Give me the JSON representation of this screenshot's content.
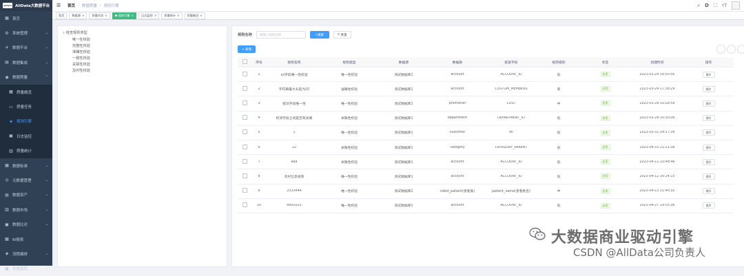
{
  "brand": {
    "logo_text": "alldata",
    "name": "AllData大数据平台"
  },
  "sidebar": {
    "items": [
      {
        "icon": "dashboard-icon",
        "glyph": "▦",
        "label": "首页",
        "type": "top"
      },
      {
        "icon": "gear-icon",
        "glyph": "⚙",
        "label": "系统管理",
        "type": "group"
      },
      {
        "icon": "send-icon",
        "glyph": "✈",
        "label": "数据平台",
        "type": "group"
      },
      {
        "icon": "chart-icon",
        "glyph": "▤",
        "label": "数据集成",
        "type": "group"
      },
      {
        "icon": "database-icon",
        "glyph": "◉",
        "label": "数据质量",
        "type": "group",
        "open": true
      },
      {
        "icon": "grid-icon",
        "glyph": "▦",
        "label": "质量概览",
        "type": "sub"
      },
      {
        "icon": "document-icon",
        "glyph": "▭",
        "label": "质量任务",
        "type": "sub"
      },
      {
        "icon": "rule-icon",
        "glyph": "◈",
        "label": "规则引擎",
        "type": "sub",
        "active": true
      },
      {
        "icon": "monitor-icon",
        "glyph": "▣",
        "label": "日志监控",
        "type": "sub"
      },
      {
        "icon": "statistics-icon",
        "glyph": "▥",
        "label": "质量统计",
        "type": "sub"
      },
      {
        "icon": "standard-icon",
        "glyph": "▦",
        "label": "数据标准",
        "type": "group"
      },
      {
        "icon": "metadata-icon",
        "glyph": "◎",
        "label": "元数据管理",
        "type": "group"
      },
      {
        "icon": "asset-icon",
        "glyph": "▤",
        "label": "数据资产",
        "type": "group"
      },
      {
        "icon": "market-icon",
        "glyph": "▥",
        "label": "数据市场",
        "type": "group"
      },
      {
        "icon": "compare-icon",
        "glyph": "▣",
        "label": "数据比对",
        "type": "group"
      },
      {
        "icon": "table-icon",
        "glyph": "▦",
        "label": "BI报表",
        "type": "top"
      },
      {
        "icon": "flow-icon",
        "glyph": "◈",
        "label": "流程编排",
        "type": "group"
      },
      {
        "icon": "system-monitor-icon",
        "glyph": "▣",
        "label": "系统监控",
        "type": "group"
      }
    ]
  },
  "breadcrumb": [
    "首页",
    "数据质量",
    "规则引擎"
  ],
  "tags": [
    {
      "label": "首页",
      "active": false,
      "closable": false
    },
    {
      "label": "数据源",
      "active": false,
      "closable": true
    },
    {
      "label": "质量任务",
      "active": false,
      "closable": true
    },
    {
      "label": "规则引擎",
      "active": true,
      "closable": true
    },
    {
      "label": "日志监控",
      "active": false,
      "closable": true
    },
    {
      "label": "质量统计",
      "active": false,
      "closable": true
    },
    {
      "label": "质量概况",
      "active": false,
      "closable": true
    }
  ],
  "tree": {
    "root": "核查规则类型",
    "children": [
      "唯一性校验",
      "完整性校验",
      "准确性校验",
      "一致性校验",
      "关联性校验",
      "及时性校验"
    ]
  },
  "search": {
    "label": "规则名称",
    "placeholder": "请输入规则名称",
    "search_label": "搜索",
    "reset_label": "重置",
    "add_label": "+ 新增"
  },
  "table": {
    "headers": [
      "",
      "序号",
      "规则名称",
      "规则类型",
      "数据源",
      "数据表",
      "核查字段",
      "规则级别",
      "状态",
      "创建时间",
      "操作"
    ],
    "rows": [
      [
        "1",
        "xx字段唯一性校验",
        "唯一性校验",
        "测试数据库1",
        "account",
        "ACCOUNT_ID",
        "低",
        "启用",
        "2023-03-24 16:50:56",
        "操作"
      ],
      [
        "2",
        "字符串最大长度为10",
        "准确性校验",
        "测试数据库1",
        "account",
        "CUSTOM_MEMBERS",
        "高",
        "启用",
        "2023-03-24 17:38:29",
        "操作"
      ],
      [
        "3",
        "核派字段唯一性",
        "唯一性校验",
        "测试数据库1",
        "promotion",
        "COST",
        "中",
        "启用",
        "2023-03-28 10:28:59",
        "操作"
      ],
      [
        "4",
        "校测字段之间是否有关联",
        "关联性校验",
        "测试数据库1",
        "department",
        "DEPARTMENT_ID",
        "低",
        "启用",
        "2023-03-28 10:30:06",
        "操作"
      ],
      [
        "5",
        "1",
        "唯一性校验",
        "测试数据库1",
        "customer",
        "MI",
        "低",
        "启用",
        "2023-03-31 09:17:34",
        "操作"
      ],
      [
        "6",
        "22",
        "关联性校验",
        "测试数据库1",
        "category",
        "CATEGORY_PARENT",
        "低",
        "启用",
        "2023-04-10 21:21:38",
        "操作"
      ],
      [
        "7",
        "aaa",
        "关联性校验",
        "测试数据库1",
        "account",
        "ACCOUNT_ID",
        "低",
        "启用",
        "2023-04-11 10:48:46",
        "操作"
      ],
      [
        "8",
        "农村信息规则",
        "唯一性校验",
        "测试数据库1",
        "account",
        "ACCOUNT_ID",
        "低",
        "启用",
        "2023-04-12 16:14:15",
        "操作"
      ],
      [
        "9",
        "2333444",
        "唯一性校验",
        "测试数据库2",
        "robot_patient(患者表)",
        "patient_name(患者姓名)",
        "中",
        "启用",
        "2023-04-13 21:40:32",
        "操作"
      ],
      [
        "10",
        "test2023",
        "唯一性校验",
        "测试数据库1",
        "account",
        "ACCOUNT_ID",
        "低",
        "启用",
        "2023-04-27 19:55:36",
        "操作"
      ]
    ]
  },
  "watermark": {
    "line1": "大数据商业驱动引擎",
    "line2": "CSDN @AllData公司负责人"
  }
}
